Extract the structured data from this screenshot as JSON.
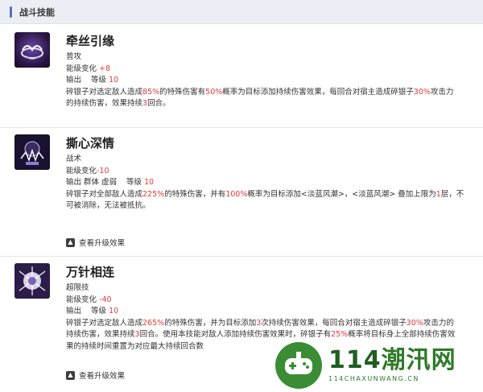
{
  "header": {
    "title": "战斗技能"
  },
  "skills": [
    {
      "name": "牵丝引缘",
      "type": "普攻",
      "energy_label": "能级变化",
      "energy_value": "+8",
      "output_label": "输出",
      "level_label": "等级",
      "level_value": "10",
      "desc_lines": [
        [
          "碎银子对选定敌人造成",
          "85%",
          "的特殊伤害有",
          "50%",
          "概率为目标添加持续伤害效果，每回合对宿主造成碎银子",
          "30%",
          "攻击力"
        ],
        [
          "的持续伤害，效果持续",
          "3",
          "回合。"
        ]
      ]
    },
    {
      "name": "撕心深情",
      "type": "战术",
      "energy_label": "能级变化",
      "energy_value": "-10",
      "output_label": "输出 群体 虚弱",
      "level_label": "等级",
      "level_value": "10",
      "desc_lines": [
        [
          "碎银子对全部敌人造成",
          "225%",
          "的特殊伤害，并有",
          "100%",
          "概率为目标添加<淡蓝风潮>，<淡蓝风潮> 叠加上限为",
          "1",
          "层，不"
        ],
        [
          "可被消除，无法被抵抗。"
        ]
      ],
      "upgrade_label": "查看升级效果"
    },
    {
      "name": "万针相连",
      "type": "超限技",
      "energy_label": "能级变化",
      "energy_value": "-40",
      "output_label": "输出",
      "level_label": "等级",
      "level_value": "10",
      "desc_lines": [
        [
          "碎银子对选定敌人造成",
          "265%",
          "的特殊伤害，并为目标添加",
          "3",
          "次持续伤害效果，每回合对宿主造成碎银子",
          "30%",
          "攻击力的"
        ],
        [
          "持续伤害，效果持续",
          "3",
          "回合。使用本技能对敌人添加持续伤害效果时，碎银子有",
          "25%",
          "概率将目标身上全部持续伤害效"
        ],
        [
          "果的持续时间重置为对应最大持续回合数"
        ]
      ],
      "upgrade_label": "查看升级效果"
    }
  ],
  "watermark": {
    "main_num": "114",
    "main_text": "潮汛网",
    "sub": "114CHAXUNWANG.CN"
  },
  "colors": {
    "highlight": "#e23b3b",
    "header_bg": "#eceef5",
    "accent": "#5a6fb6",
    "watermark": "#2f7a2a"
  },
  "icons": [
    "skill-icon-bow",
    "skill-icon-tear",
    "skill-icon-needles",
    "upgrade-arrow-icon",
    "game-controller-icon"
  ]
}
